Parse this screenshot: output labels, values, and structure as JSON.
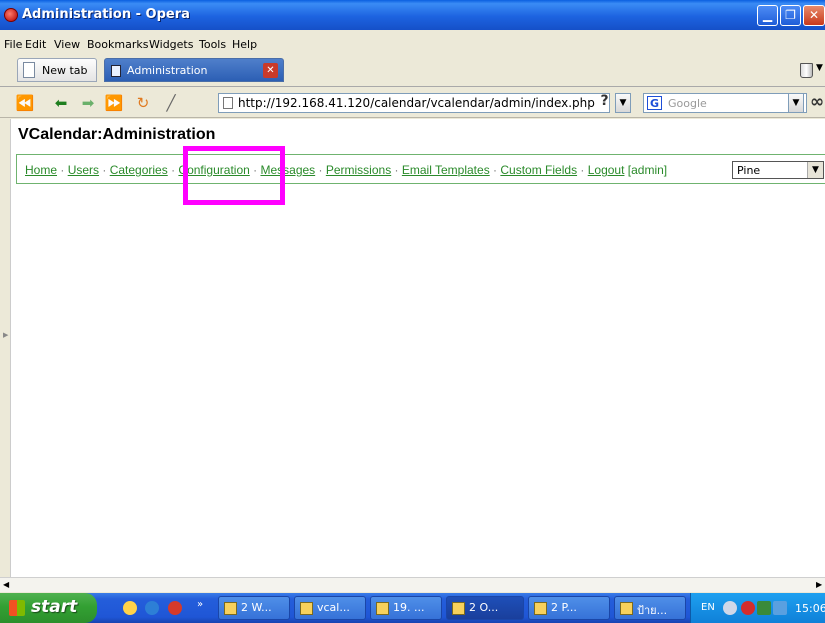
{
  "window": {
    "title": "Administration - Opera"
  },
  "menubar": {
    "items": [
      "File",
      "Edit",
      "View",
      "Bookmarks",
      "Widgets",
      "Tools",
      "Help"
    ]
  },
  "tabs": {
    "new_tab": "New tab",
    "active_tab": "Administration"
  },
  "navbar": {
    "url": "http://192.168.41.120/calendar/vcalendar/admin/index.php",
    "search_placeholder": "Google",
    "help_glyph": "?"
  },
  "page": {
    "title": "VCalendar:Administration",
    "menu": {
      "links": [
        "Home",
        "Users",
        "Categories",
        "Configuration",
        "Messages",
        "Permissions",
        "Email Templates",
        "Custom Fields",
        "Logout"
      ],
      "user": "[admin]",
      "style_select_value": "Pine"
    },
    "highlight_color": "#ff00ff"
  },
  "taskbar": {
    "start_label": "start",
    "buttons": [
      "2 W...",
      "vcal...",
      "19. ...",
      "2 O...",
      "2 P...",
      "ป้าย..."
    ],
    "language": "EN",
    "clock": "15:06"
  }
}
